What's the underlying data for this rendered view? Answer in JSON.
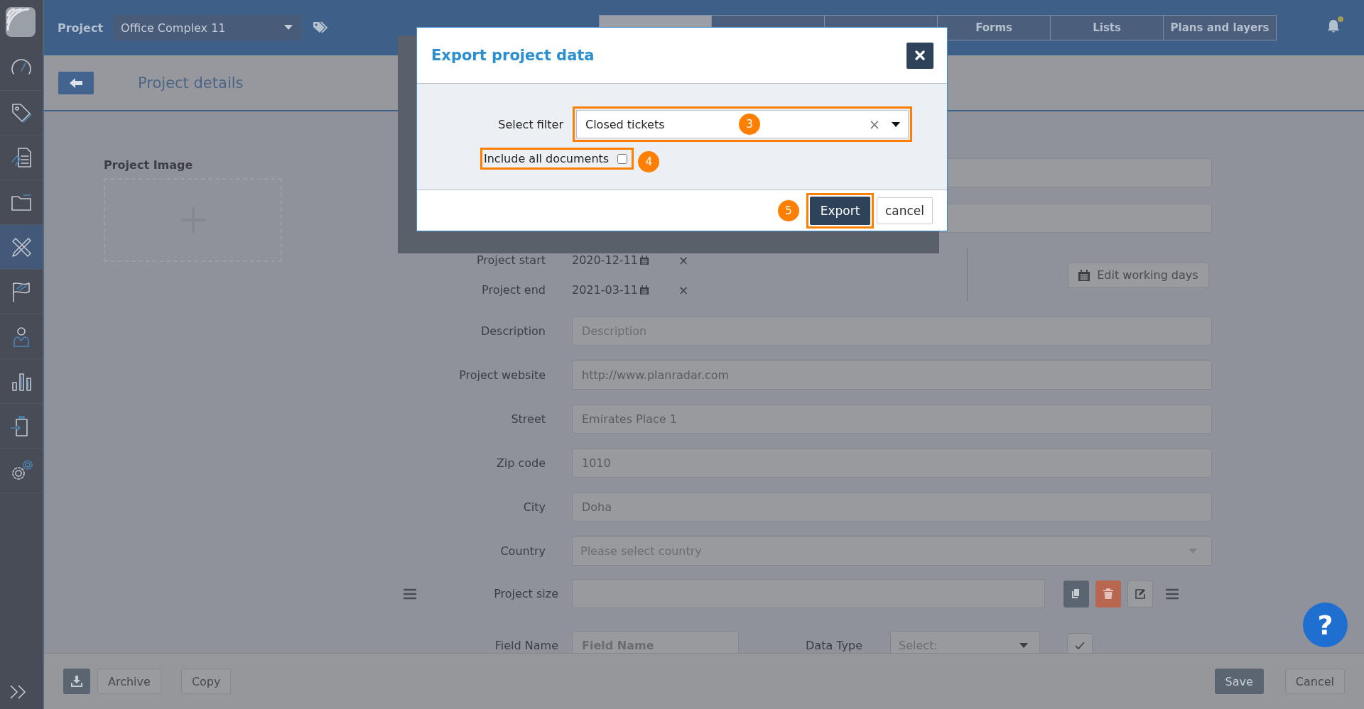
{
  "topbar": {
    "project_label": "Project",
    "project_select": "Office Complex 11",
    "tabs": [
      {
        "selected": true
      },
      {
        "selected": false
      },
      {
        "selected": false
      },
      {
        "label": "Forms",
        "selected": false
      },
      {
        "label": "Lists",
        "selected": false
      },
      {
        "label": "Plans and layers",
        "selected": false
      }
    ],
    "notification_dot": true
  },
  "sidebar": {
    "items": [
      {
        "selected": false
      },
      {
        "selected": false
      },
      {
        "selected": false
      },
      {
        "selected": false
      },
      {
        "selected": true
      },
      {
        "selected": false
      },
      {
        "selected": false
      },
      {
        "selected": false
      },
      {
        "selected": false
      },
      {
        "selected": false
      }
    ]
  },
  "page": {
    "title": "Project details"
  },
  "image_panel": {
    "label": "Project Image"
  },
  "form": {
    "rows": [
      {
        "kind": "blank"
      },
      {
        "kind": "blank"
      }
    ],
    "dates": {
      "rows": [
        {
          "label": "Project start",
          "value": "2020-12-11",
          "clear": "×"
        },
        {
          "label": "Project end",
          "value": "2021-03-11",
          "clear": "×"
        }
      ],
      "button": "Edit working days"
    },
    "fields": [
      {
        "kind": "input",
        "label": "Description",
        "placeholder": "Description"
      },
      {
        "kind": "input",
        "label": "Project website",
        "value": "http://www.planradar.com"
      },
      {
        "kind": "input",
        "label": "Street",
        "value": "Emirates Place 1"
      },
      {
        "kind": "input",
        "label": "Zip code",
        "value": "1010"
      },
      {
        "kind": "input",
        "label": "City",
        "value": "Doha"
      },
      {
        "kind": "select",
        "label": "Country",
        "placeholder": "Please select country"
      }
    ],
    "custom_field": {
      "label": "Project size"
    },
    "new_field": {
      "name_label": "Field Name",
      "name_placeholder": "Field Name",
      "type_label": "Data Type",
      "type_placeholder": "Select:"
    }
  },
  "footer": {
    "left_buttons": [
      "Archive",
      "Copy"
    ],
    "right_buttons": [
      "Save",
      "Cancel"
    ]
  },
  "help_button": "?",
  "modal": {
    "title": "Export project data",
    "filter_label": "Select filter",
    "filter_value": "Closed tickets",
    "filter_clear": "×",
    "include_label": "Include all documents",
    "include_checked": false,
    "buttons": [
      "Export",
      "cancel"
    ],
    "step_badges": [
      "3",
      "4",
      "5"
    ]
  }
}
